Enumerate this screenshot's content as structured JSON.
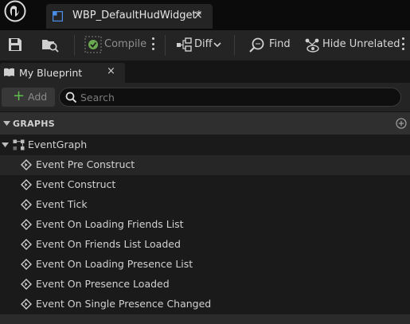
{
  "document_tab": {
    "title": "WBP_DefaultHudWidget*",
    "close": "×"
  },
  "toolbar": {
    "compile_label": "Compile",
    "diff_label": "Diff",
    "find_label": "Find",
    "hide_unrelated_label": "Hide Unrelated"
  },
  "panel": {
    "tab_label": "My Blueprint",
    "close": "×",
    "add_label": "Add",
    "search_placeholder": "Search"
  },
  "graphs": {
    "section_label": "GRAPHS",
    "event_graph_label": "EventGraph",
    "events": [
      "Event Pre Construct",
      "Event Construct",
      "Event Tick",
      "Event On Loading Friends List",
      "Event On Friends List Loaded",
      "Event On Loading Presence List",
      "Event On Presence Loaded",
      "Event On Single Presence Changed"
    ]
  },
  "colors": {
    "accent_blue": "#3d7fe0",
    "add_green": "#5fbf4e",
    "compile_check": "#6aa84f",
    "highlight_row": "#262626"
  }
}
